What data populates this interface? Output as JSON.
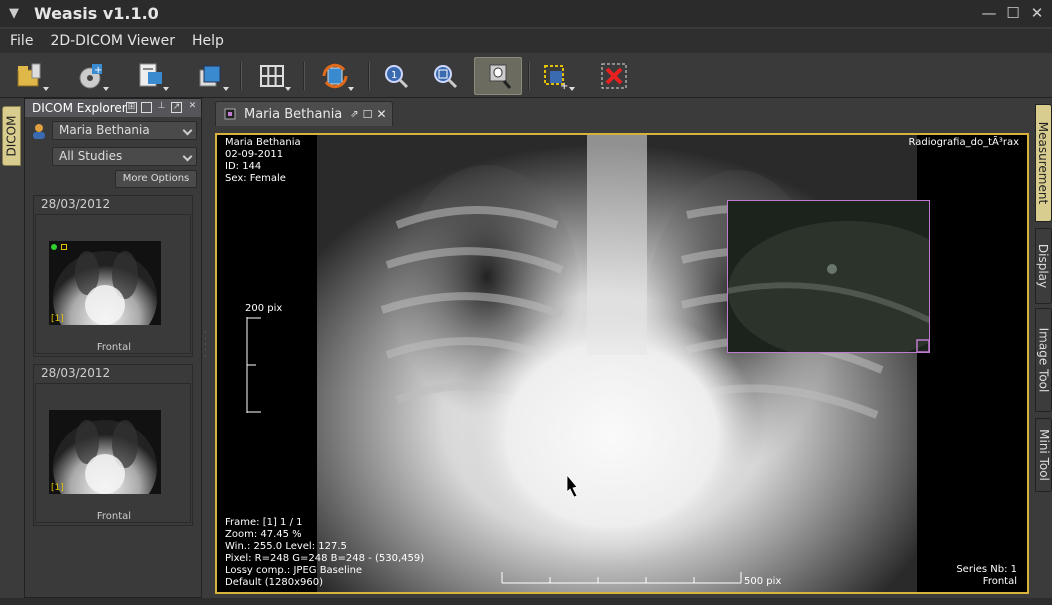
{
  "window": {
    "title": "Weasis v1.1.0"
  },
  "menu": [
    "File",
    "2D-DICOM Viewer",
    "Help"
  ],
  "left_sidetab": "DICOM",
  "explorer": {
    "title": "DICOM Explorer",
    "patient": "Maria Bethania",
    "studies_filter": "All Studies",
    "more_options": "More Options",
    "studies": [
      {
        "date": "28/03/2012",
        "series_label": "Frontal",
        "index": "[1]"
      },
      {
        "date": "28/03/2012",
        "series_label": "Frontal",
        "index": "[1]"
      }
    ]
  },
  "viewer_tab": {
    "label": "Maria Bethania"
  },
  "overlay": {
    "top_left": [
      "Maria Bethania",
      "02-09-2011",
      "ID: 144",
      "Sex: Female"
    ],
    "top_right": "Radiografia_do_tÃ³rax",
    "scale_label": "200 pix",
    "bottom_left": [
      "Frame: [1] 1 / 1",
      "Zoom: 47.45 %",
      "Win.: 255.0 Level: 127.5",
      "Pixel: R=248 G=248 B=248 - (530,459)"
    ],
    "lossy": "Lossy comp.: JPEG Baseline",
    "default_size": "Default (1280x960)",
    "ruler_label": "500 pix",
    "series_nb": "Series Nb: 1",
    "orientation": "Frontal"
  },
  "right_sidetabs": [
    "Measurement",
    "Display",
    "Image Tool",
    "Mini Tool"
  ],
  "colors": {
    "accent_frame": "#d7b33c",
    "minitool_border": "#c07ad0",
    "lossy_text": "#ff2a2a"
  }
}
